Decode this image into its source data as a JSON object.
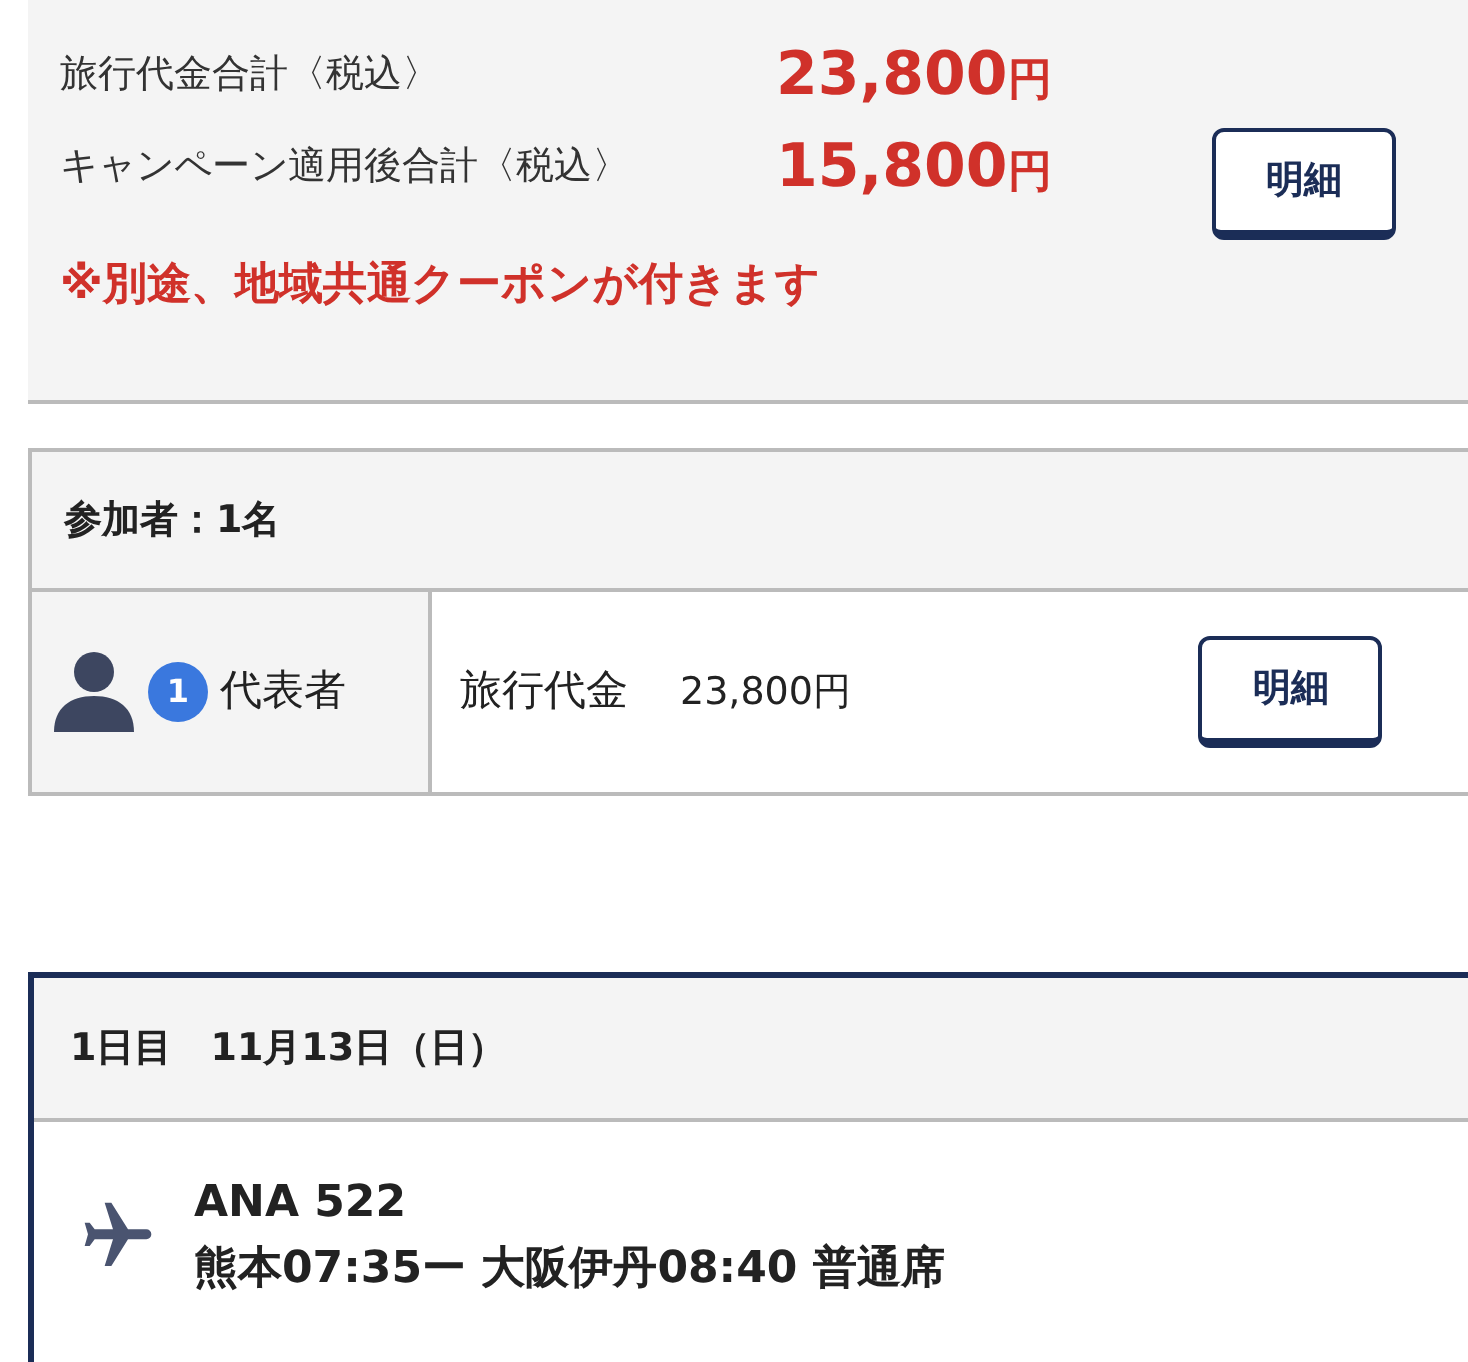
{
  "summary": {
    "rows": [
      {
        "label": "旅行代金合計〈税込〉",
        "amount": "23,800",
        "unit": "円"
      },
      {
        "label": "キャンペーン適用後合計〈税込〉",
        "amount": "15,800",
        "unit": "円"
      }
    ],
    "detail_button": "明細",
    "notice": "※別途、地域共通クーポンが付きます"
  },
  "participants": {
    "title": "参加者：1名",
    "rows": [
      {
        "number": "1",
        "role": "代表者",
        "fee_label": "旅行代金",
        "fee": "23,800円",
        "detail_button": "明細"
      }
    ]
  },
  "itinerary": {
    "day": "1日目　11月13日（日）",
    "flights": [
      {
        "flight": "ANA 522",
        "route": "熊本07:35ー 大阪伊丹08:40 普通席"
      }
    ]
  }
}
